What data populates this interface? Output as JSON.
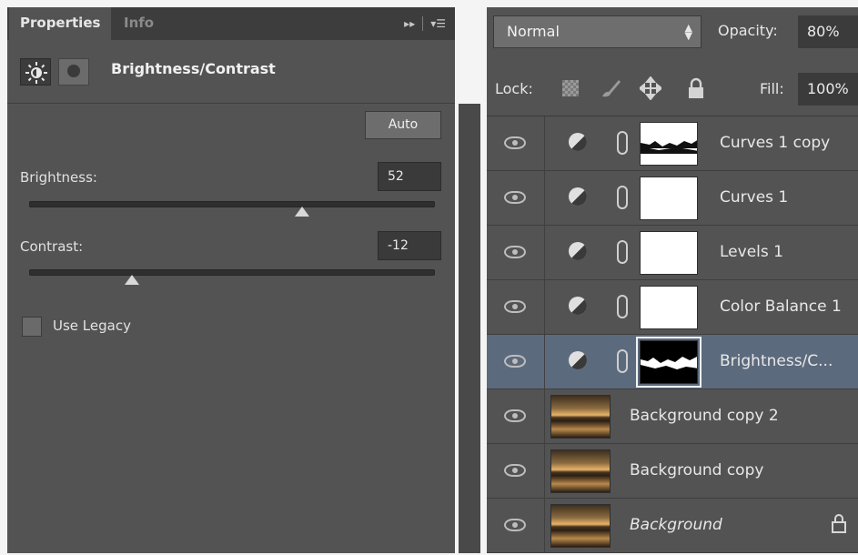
{
  "properties_panel": {
    "tabs": [
      {
        "label": "Properties",
        "active": true
      },
      {
        "label": "Info",
        "active": false
      }
    ],
    "collapse_glyph": "▸▸",
    "menu_glyph": "▾☰",
    "adjustment_icon": "sun-icon",
    "mask_icon": "layer-mask-icon",
    "adjustment_title": "Brightness/Contrast",
    "auto_label": "Auto",
    "brightness": {
      "label": "Brightness:",
      "value": "52",
      "min": -150,
      "max": 150
    },
    "contrast": {
      "label": "Contrast:",
      "value": "-12",
      "min": -50,
      "max": 100
    },
    "use_legacy": {
      "label": "Use Legacy",
      "checked": false
    }
  },
  "layers_panel": {
    "blend_mode": "Normal",
    "opacity": {
      "label": "Opacity:",
      "value": "80%"
    },
    "lock": {
      "label": "Lock:",
      "icons": [
        "lock-transparent-icon",
        "lock-brush-icon",
        "lock-move-icon",
        "lock-all-icon"
      ]
    },
    "fill": {
      "label": "Fill:",
      "value": "100%"
    },
    "layers": [
      {
        "name": "Curves 1 copy",
        "type": "adjustment",
        "mask": "horizon",
        "selected": false
      },
      {
        "name": "Curves 1",
        "type": "adjustment",
        "mask": "white",
        "selected": false
      },
      {
        "name": "Levels 1",
        "type": "adjustment",
        "mask": "white",
        "selected": false
      },
      {
        "name": "Color Balance 1",
        "type": "adjustment",
        "mask": "white",
        "selected": false
      },
      {
        "name": "Brightness/C...",
        "type": "adjustment",
        "mask": "dark-horizon",
        "selected": true
      },
      {
        "name": "Background copy 2",
        "type": "image",
        "selected": false
      },
      {
        "name": "Background copy",
        "type": "image",
        "selected": false
      },
      {
        "name": "Background",
        "type": "image",
        "italic": true,
        "locked": true,
        "selected": false
      }
    ]
  },
  "colors": {
    "panel_bg": "#535353",
    "tab_bar": "#3d3d3d",
    "selected_row": "#5c6a7d",
    "field_bg": "#3a3a3a"
  }
}
